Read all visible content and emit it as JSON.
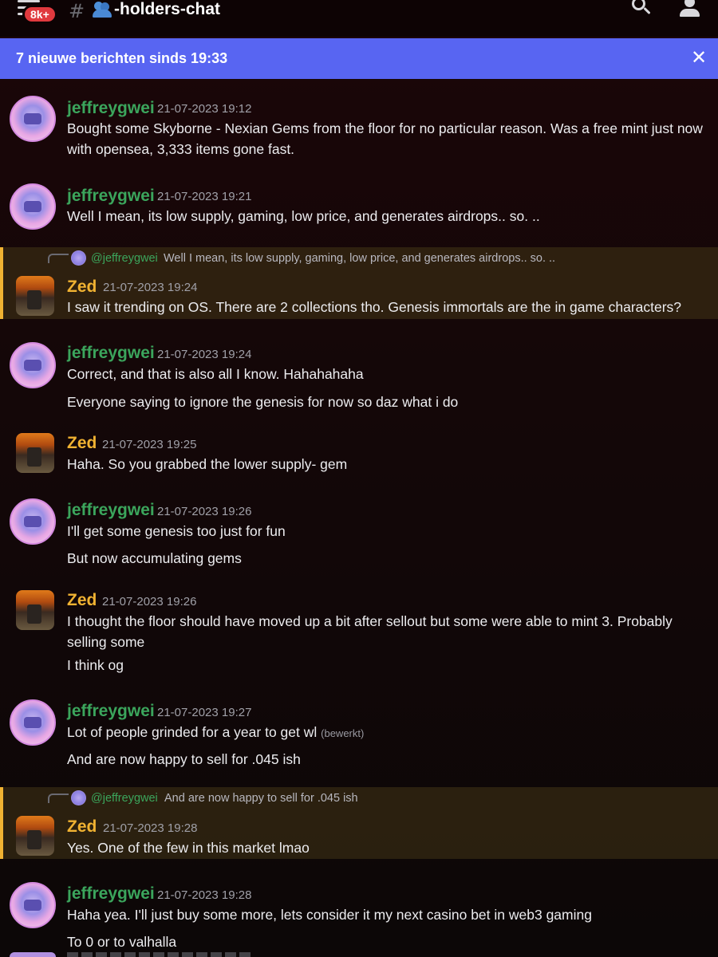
{
  "topbar": {
    "badge": "8k+",
    "hash": "#",
    "channel_name": "-holders-chat",
    "icons": [
      "menu-icon",
      "people-emoji-icon",
      "search-icon",
      "members-icon"
    ]
  },
  "banner": {
    "text": "7 nieuwe berichten sinds 19:33",
    "close": "✕"
  },
  "colors": {
    "banner": "#5865f2",
    "author_jeffrey": "#3ba55c",
    "author_zed": "#f0b232",
    "badge": "#e0393e",
    "reply_highlight_bar": "#f0b232"
  },
  "messages": [
    {
      "author": "jeffreygwei",
      "timestamp": "21-07-2023 19:12",
      "lines": [
        "Bought some Skyborne - Nexian Gems from the floor for no particular reason. Was a free mint just now",
        "with opensea, 3,333 items gone fast."
      ]
    },
    {
      "author": "jeffreygwei",
      "timestamp": "21-07-2023 19:21",
      "lines": [
        "Well I mean, its low supply, gaming, low price, and generates airdrops.. so. .."
      ]
    },
    {
      "author": "Zed",
      "timestamp": "21-07-2023 19:24",
      "reply": {
        "mention": "@jeffreygwei",
        "text": "Well I mean, its low supply, gaming, low price, and generates airdrops.. so. .."
      },
      "lines": [
        "I saw it trending on OS. There are 2 collections tho. Genesis immortals are the in game characters?"
      ]
    },
    {
      "author": "jeffreygwei",
      "timestamp": "21-07-2023 19:24",
      "lines": [
        "Correct, and that is also all I know. Hahahahaha",
        "Everyone saying to ignore the genesis for now so daz what i do"
      ]
    },
    {
      "author": "Zed",
      "timestamp": "21-07-2023 19:25",
      "lines": [
        "Haha. So you grabbed the lower supply- gem"
      ]
    },
    {
      "author": "jeffreygwei",
      "timestamp": "21-07-2023 19:26",
      "lines": [
        "I'll get some genesis too just for fun",
        "But now accumulating gems"
      ]
    },
    {
      "author": "Zed",
      "timestamp": "21-07-2023 19:26",
      "lines": [
        "I thought the floor should have moved up a bit after sellout but some were able to mint 3. Probably",
        "selling some",
        "I think og"
      ]
    },
    {
      "author": "jeffreygwei",
      "timestamp": "21-07-2023 19:27",
      "lines": [
        "Lot of people grinded for a year to get wl",
        "And are now happy to sell for .045 ish"
      ],
      "edited": "(bewerkt)"
    },
    {
      "author": "Zed",
      "timestamp": "21-07-2023 19:28",
      "reply": {
        "mention": "@jeffreygwei",
        "text": "And are now happy to sell for .045 ish"
      },
      "lines": [
        "Yes. One of the few in this market lmao"
      ]
    },
    {
      "author": "jeffreygwei",
      "timestamp": "21-07-2023 19:28",
      "lines": [
        "Haha yea. I'll just buy some more, lets consider it my next casino bet in web3 gaming",
        "To 0 or to valhalla"
      ]
    }
  ]
}
